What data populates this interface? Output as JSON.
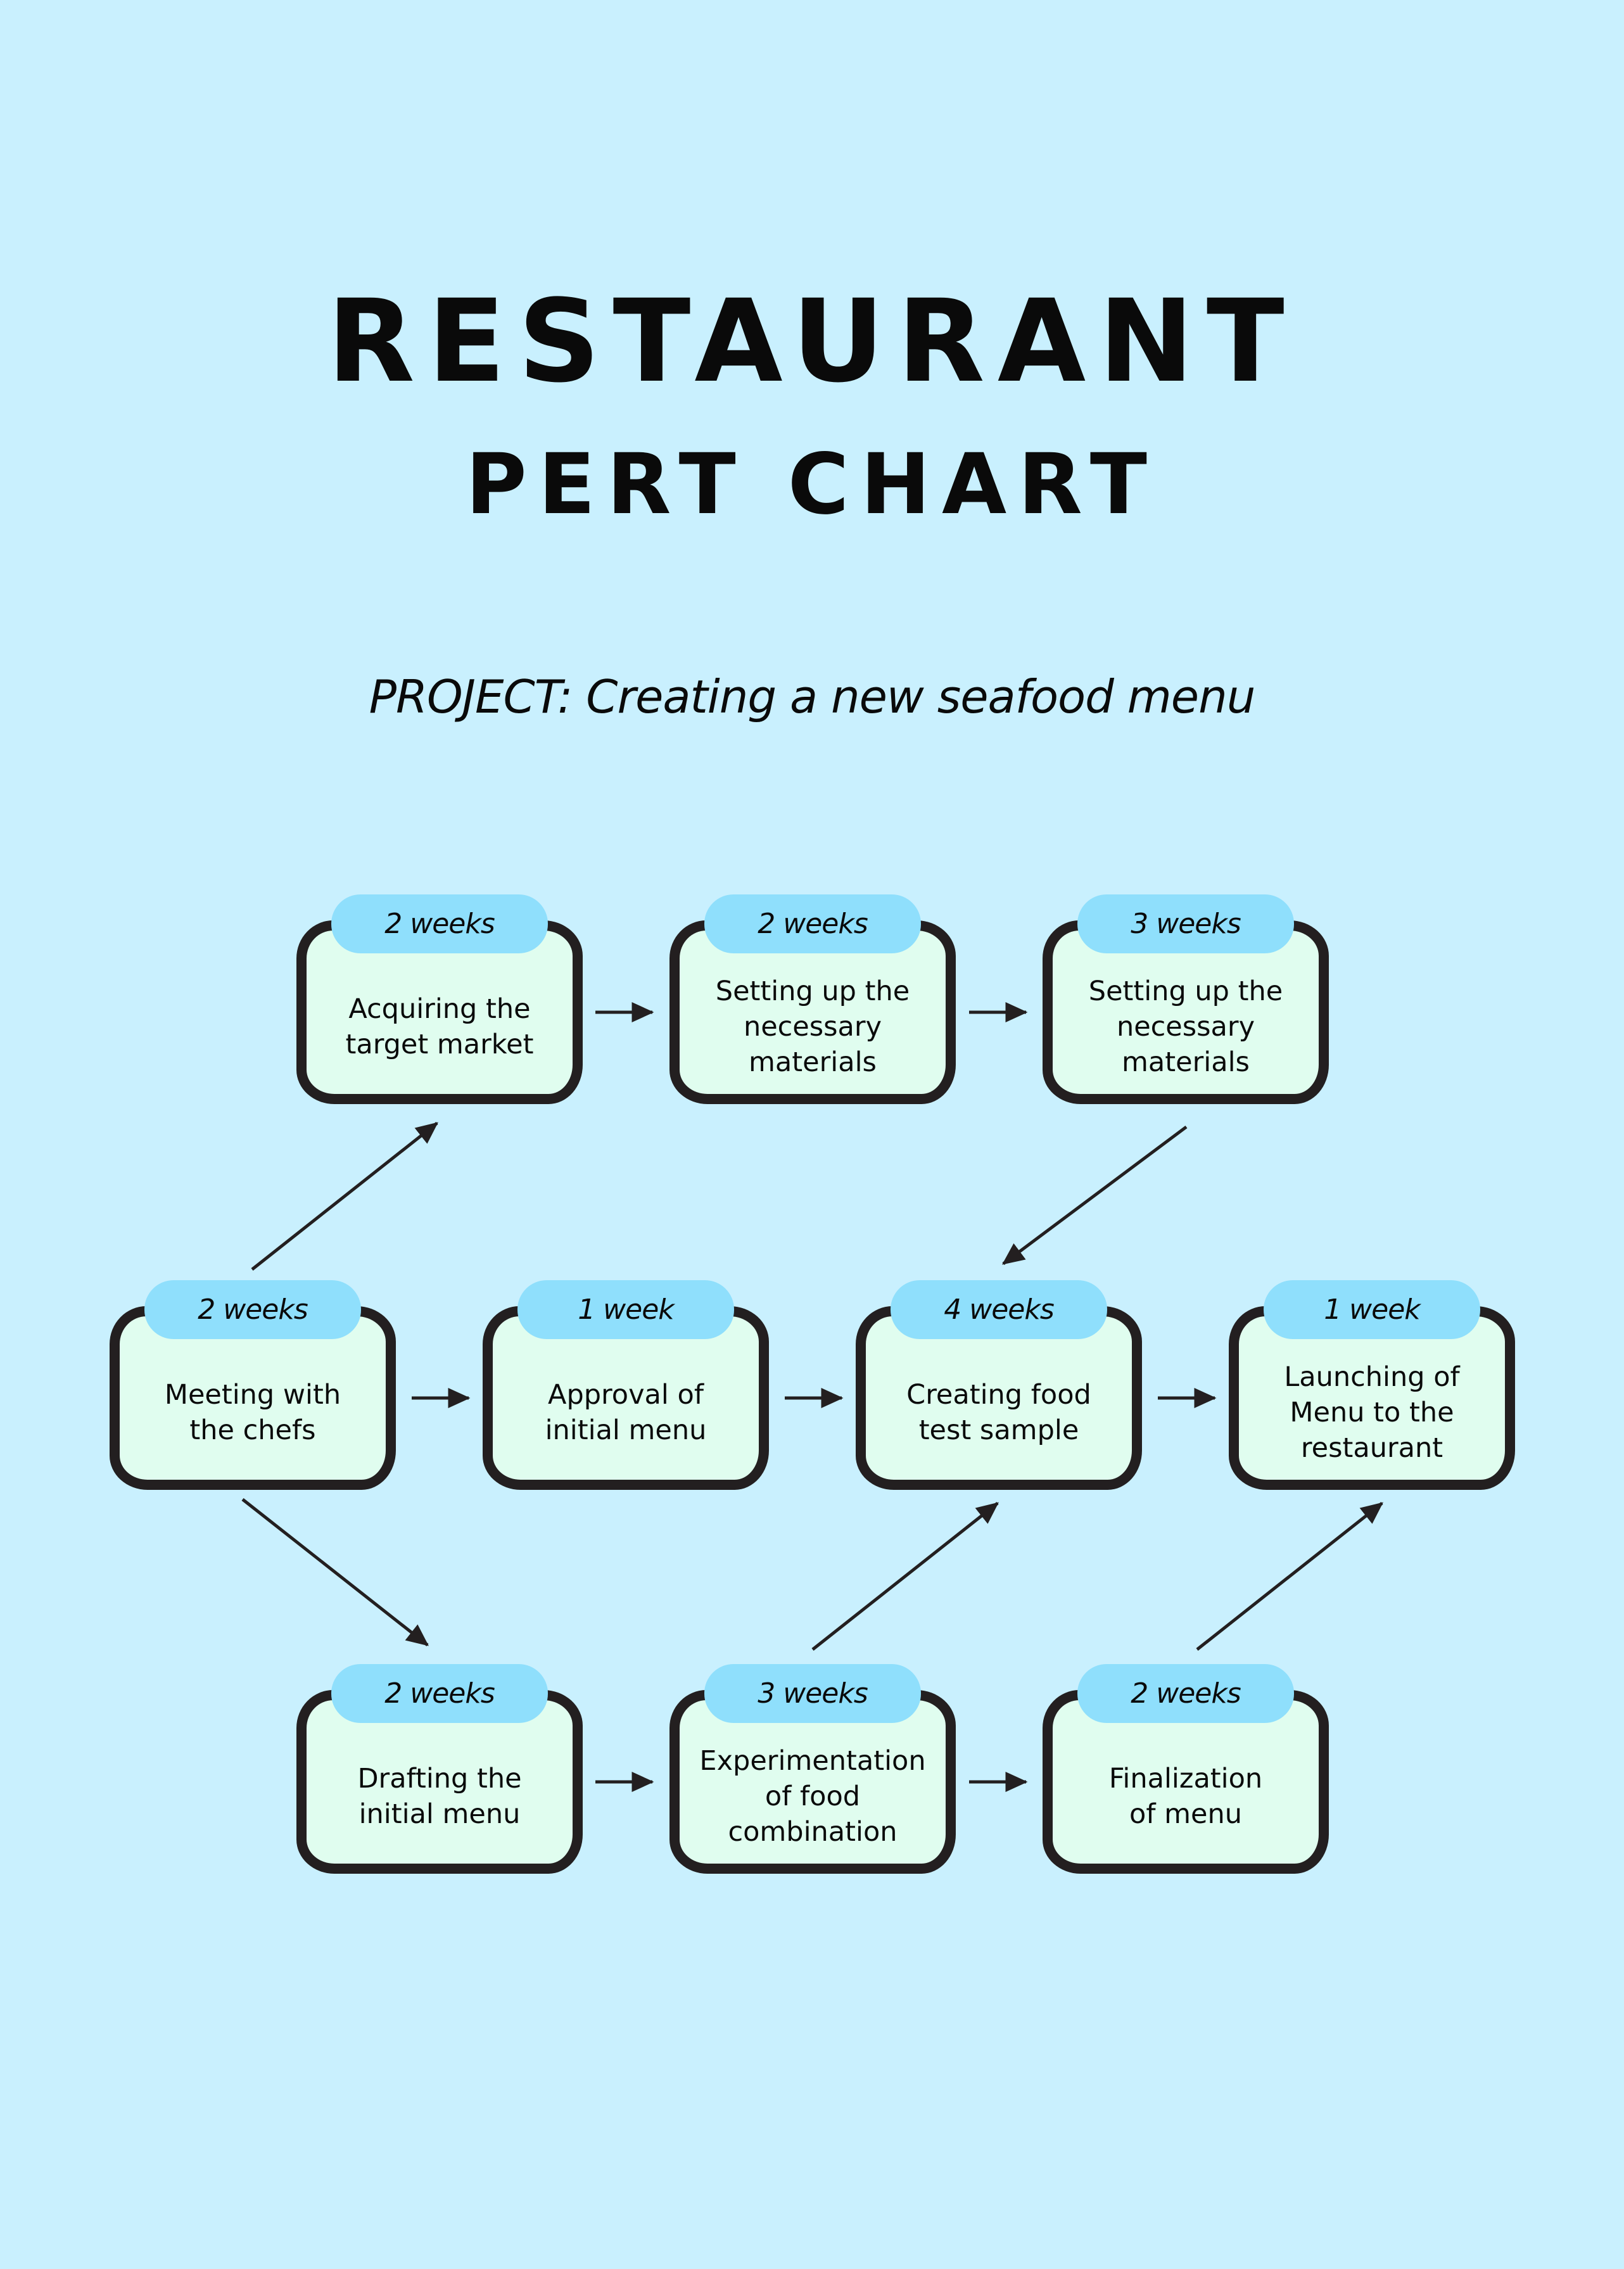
{
  "header": {
    "title": "RESTAURANT",
    "subtitle": "PERT CHART",
    "project": "PROJECT: Creating a new seafood menu"
  },
  "colors": {
    "background": "#c9f0fe",
    "node_fill": "#e0fdef",
    "node_border": "#231f20",
    "duration_pill": "#8fdffc",
    "arrow": "#231f20"
  },
  "nodes": [
    {
      "id": "acquiring",
      "duration": "2 weeks",
      "label": "Acquiring the\ntarget market"
    },
    {
      "id": "setting-up-1",
      "duration": "2 weeks",
      "label": "Setting up the\nnecessary\nmaterials"
    },
    {
      "id": "setting-up-2",
      "duration": "3 weeks",
      "label": "Setting up the\nnecessary\nmaterials"
    },
    {
      "id": "meeting",
      "duration": "2 weeks",
      "label": "Meeting with\nthe chefs"
    },
    {
      "id": "approval",
      "duration": "1 week",
      "label": "Approval of\ninitial menu"
    },
    {
      "id": "creating",
      "duration": "4 weeks",
      "label": "Creating food\ntest sample"
    },
    {
      "id": "launching",
      "duration": "1 week",
      "label": "Launching of\nMenu to the\nrestaurant"
    },
    {
      "id": "drafting",
      "duration": "2 weeks",
      "label": "Drafting the\ninitial menu"
    },
    {
      "id": "experimentation",
      "duration": "3 weeks",
      "label": "Experimentation\nof food\ncombination"
    },
    {
      "id": "finalization",
      "duration": "2 weeks",
      "label": "Finalization\nof menu"
    }
  ],
  "edges": [
    {
      "from": "meeting",
      "to": "acquiring"
    },
    {
      "from": "acquiring",
      "to": "setting-up-1"
    },
    {
      "from": "setting-up-1",
      "to": "setting-up-2"
    },
    {
      "from": "setting-up-2",
      "to": "creating"
    },
    {
      "from": "meeting",
      "to": "approval"
    },
    {
      "from": "approval",
      "to": "creating"
    },
    {
      "from": "creating",
      "to": "launching"
    },
    {
      "from": "meeting",
      "to": "drafting"
    },
    {
      "from": "drafting",
      "to": "experimentation"
    },
    {
      "from": "experimentation",
      "to": "creating"
    },
    {
      "from": "experimentation",
      "to": "finalization"
    },
    {
      "from": "finalization",
      "to": "launching"
    }
  ]
}
